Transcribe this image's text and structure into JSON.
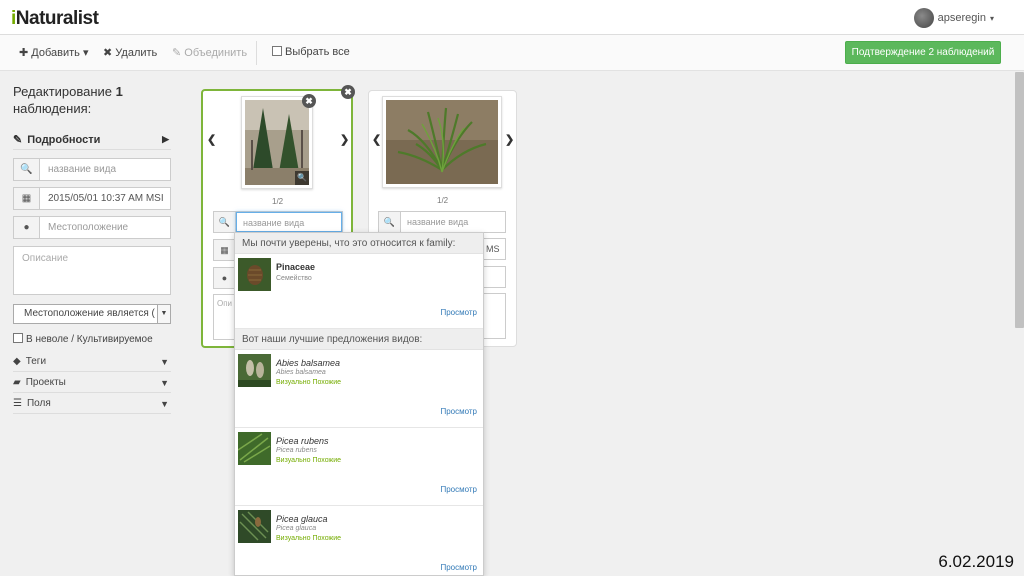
{
  "header": {
    "logo_prefix": "i",
    "logo_rest": "Naturalist",
    "username": "apseregin",
    "user_caret": "▾"
  },
  "toolbar": {
    "add": "✚ Добавить ▾",
    "delete": "✖ Удалить",
    "merge": "✎ Объединить",
    "select_all": "Выбрать все",
    "confirm": "Подтверждение 2 наблюдений"
  },
  "sidebar": {
    "title_prefix": "Редактирование ",
    "title_count": "1",
    "title_suffix": "наблюдения:",
    "details": "Подробности",
    "species_placeholder": "название вида",
    "datetime": "2015/05/01 10:37 AM MSI",
    "location_placeholder": "Местоположение",
    "description_placeholder": "Описание",
    "location_select": "Местоположение является (",
    "captive": "В неволе / Культивируемое",
    "tags": "Теги",
    "projects": "Проекты",
    "fields": "Поля"
  },
  "cards": [
    {
      "photo_count": "1/2",
      "species_placeholder": "название вида",
      "desc_placeholder": "Опи"
    },
    {
      "photo_count": "1/2",
      "species_placeholder": "название вида",
      "tz": "MS"
    }
  ],
  "dropdown": {
    "header1": "Мы почти уверены, что это относится к family:",
    "header2": "Вот наши лучшие предложения видов:",
    "family": {
      "name": "Pinaceae",
      "sub": "Семейство",
      "view": "Просмотр"
    },
    "species": [
      {
        "name": "Abies balsamea",
        "sub": "Abies balsamea",
        "vis": "Визуально Похожие",
        "view": "Просмотр"
      },
      {
        "name": "Picea rubens",
        "sub": "Picea rubens",
        "vis": "Визуально Похожие",
        "view": "Просмотр"
      },
      {
        "name": "Picea glauca",
        "sub": "Picea glauca",
        "vis": "Визуально Похожие",
        "view": "Просмотр"
      }
    ]
  },
  "footer": {
    "date": "6.02.2019"
  },
  "colors": {
    "brand_green": "#74ac00",
    "confirm_green": "#5cb85c",
    "link_blue": "#337ab7",
    "selected_border": "#7eb53a"
  }
}
